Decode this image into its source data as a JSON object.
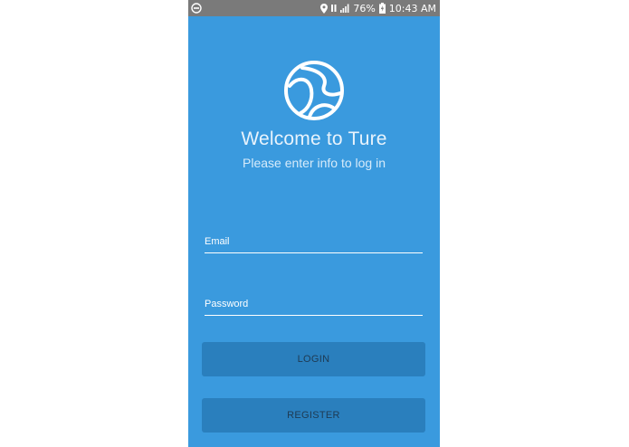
{
  "status_bar": {
    "battery": "76%",
    "time": "10:43 AM",
    "icons": [
      "do-not-disturb-icon",
      "location-icon",
      "network-data-icon",
      "signal-icon",
      "battery-charging-icon"
    ]
  },
  "header": {
    "logo": "ture-logo",
    "title": "Welcome to Ture",
    "subtitle": "Please enter info to log in"
  },
  "form": {
    "email_label": "Email",
    "password_label": "Password",
    "login_label": "LOGIN",
    "register_label": "REGISTER"
  },
  "colors": {
    "background": "#3a9ade",
    "button": "#2a7fbd",
    "status_bar": "#7a7a7a"
  }
}
